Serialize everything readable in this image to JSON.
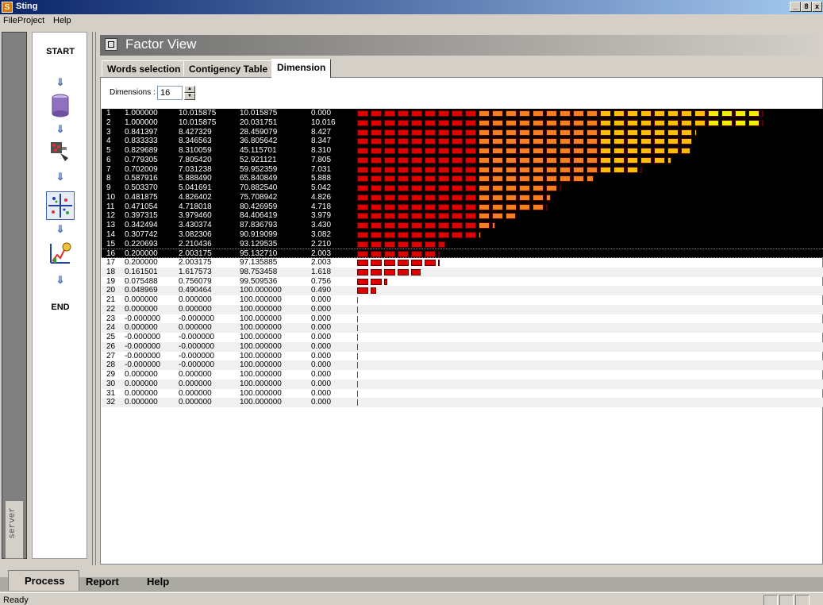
{
  "window": {
    "title": "Sting",
    "app_icon": "S",
    "min_glyph": "_",
    "max_glyph": "8",
    "close_glyph": "x"
  },
  "menu": [
    "File",
    "Project",
    "Help"
  ],
  "process": {
    "start": "START",
    "end": "END",
    "steps": [
      "database-icon",
      "filter-icon",
      "factor-analysis-icon",
      "report-chart-icon"
    ],
    "arrow": "⇓"
  },
  "side": {
    "server_tab": "server"
  },
  "factor_view": {
    "title": "Factor View",
    "tabs": [
      "Words selection",
      "Contigency Table",
      "Dimension"
    ],
    "active_tab": "Dimension"
  },
  "dimensions": {
    "label": "Dimensions :",
    "value": "16",
    "up": "▲",
    "down": "▼"
  },
  "table": {
    "highlight_count": 16,
    "rows": [
      [
        "1",
        "1.000000",
        "10.015875",
        "10.015875",
        "0.000"
      ],
      [
        "2",
        "1.000000",
        "10.015875",
        "20.031751",
        "10.016"
      ],
      [
        "3",
        "0.841397",
        "8.427329",
        "28.459079",
        "8.427"
      ],
      [
        "4",
        "0.833333",
        "8.346563",
        "36.805642",
        "8.347"
      ],
      [
        "5",
        "0.829689",
        "8.310059",
        "45.115701",
        "8.310"
      ],
      [
        "6",
        "0.779305",
        "7.805420",
        "52.921121",
        "7.805"
      ],
      [
        "7",
        "0.702009",
        "7.031238",
        "59.952359",
        "7.031"
      ],
      [
        "8",
        "0.587916",
        "5.888490",
        "65.840849",
        "5.888"
      ],
      [
        "9",
        "0.503370",
        "5.041691",
        "70.882540",
        "5.042"
      ],
      [
        "10",
        "0.481875",
        "4.826402",
        "75.708942",
        "4.826"
      ],
      [
        "11",
        "0.471054",
        "4.718018",
        "80.426959",
        "4.718"
      ],
      [
        "12",
        "0.397315",
        "3.979460",
        "84.406419",
        "3.979"
      ],
      [
        "13",
        "0.342494",
        "3.430374",
        "87.836793",
        "3.430"
      ],
      [
        "14",
        "0.307742",
        "3.082306",
        "90.919099",
        "3.082"
      ],
      [
        "15",
        "0.220693",
        "2.210436",
        "93.129535",
        "2.210"
      ],
      [
        "16",
        "0.200000",
        "2.003175",
        "95.132710",
        "2.003"
      ],
      [
        "17",
        "0.200000",
        "2.003175",
        "97.135885",
        "2.003"
      ],
      [
        "18",
        "0.161501",
        "1.617573",
        "98.753458",
        "1.618"
      ],
      [
        "19",
        "0.075488",
        "0.756079",
        "99.509536",
        "0.756"
      ],
      [
        "20",
        "0.048969",
        "0.490464",
        "100.000000",
        "0.490"
      ],
      [
        "21",
        "0.000000",
        "0.000000",
        "100.000000",
        "0.000"
      ],
      [
        "22",
        "0.000000",
        "0.000000",
        "100.000000",
        "0.000"
      ],
      [
        "23",
        "-0.000000",
        "-0.000000",
        "100.000000",
        "0.000"
      ],
      [
        "24",
        "0.000000",
        "0.000000",
        "100.000000",
        "0.000"
      ],
      [
        "25",
        "-0.000000",
        "-0.000000",
        "100.000000",
        "0.000"
      ],
      [
        "26",
        "-0.000000",
        "-0.000000",
        "100.000000",
        "0.000"
      ],
      [
        "27",
        "-0.000000",
        "-0.000000",
        "100.000000",
        "0.000"
      ],
      [
        "28",
        "-0.000000",
        "-0.000000",
        "100.000000",
        "0.000"
      ],
      [
        "29",
        "0.000000",
        "0.000000",
        "100.000000",
        "0.000"
      ],
      [
        "30",
        "0.000000",
        "0.000000",
        "100.000000",
        "0.000"
      ],
      [
        "31",
        "0.000000",
        "0.000000",
        "100.000000",
        "0.000"
      ],
      [
        "32",
        "0.000000",
        "0.000000",
        "100.000000",
        "0.000"
      ]
    ],
    "bar_colors": [
      "#e00000",
      "#f08020",
      "#f8c000",
      "#f0f000"
    ]
  },
  "bottom_tabs": {
    "process": "Process",
    "report": "Report",
    "help": "Help",
    "active": "Process"
  },
  "status": {
    "text": "Ready"
  }
}
